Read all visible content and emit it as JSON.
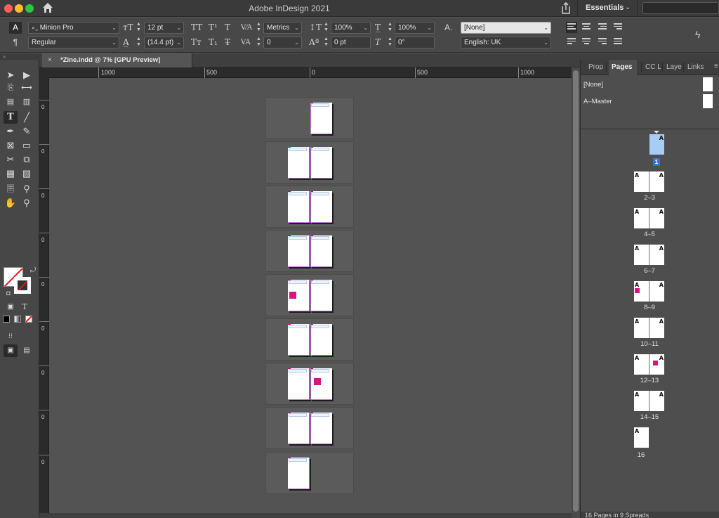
{
  "titlebar": {
    "app_title": "Adobe InDesign 2021",
    "workspace": "Essentials",
    "icons": [
      "home-icon",
      "share-icon",
      "chevron-down-icon"
    ]
  },
  "control": {
    "font_family": "Minion Pro",
    "font_style": "Regular",
    "font_size": "12 pt",
    "leading": "(14.4 pt)",
    "kerning": "Metrics",
    "tracking": "0",
    "vertical_scale": "100%",
    "horizontal_scale": "100%",
    "baseline_shift": "0 pt",
    "skew": "0°",
    "char_style": "[None]",
    "language": "English: UK"
  },
  "document": {
    "tab_label": "*Zine.indd @ 7% [GPU Preview]",
    "close_glyph": "×"
  },
  "rulers": {
    "h_labels": [
      "1000",
      "500",
      "0",
      "500",
      "1000"
    ],
    "v_label": "0"
  },
  "panel": {
    "tabs": [
      "Prop",
      "Pages",
      "CC L",
      "Laye",
      "Links"
    ],
    "active_tab": "Pages",
    "masters": [
      "[None]",
      "A–Master"
    ],
    "master_prefix": "A",
    "spread_labels": [
      "1",
      "2–3",
      "4–5",
      "6–7",
      "8–9",
      "10–11",
      "12–13",
      "14–15",
      "16"
    ],
    "footer": "16 Pages in 9 Spreads"
  },
  "colors": {
    "accent_selection": "#a8cdf5",
    "page_badge": "#2b78d8",
    "magenta_object": "#d7157d",
    "fill_none_slash": "#e01818"
  }
}
